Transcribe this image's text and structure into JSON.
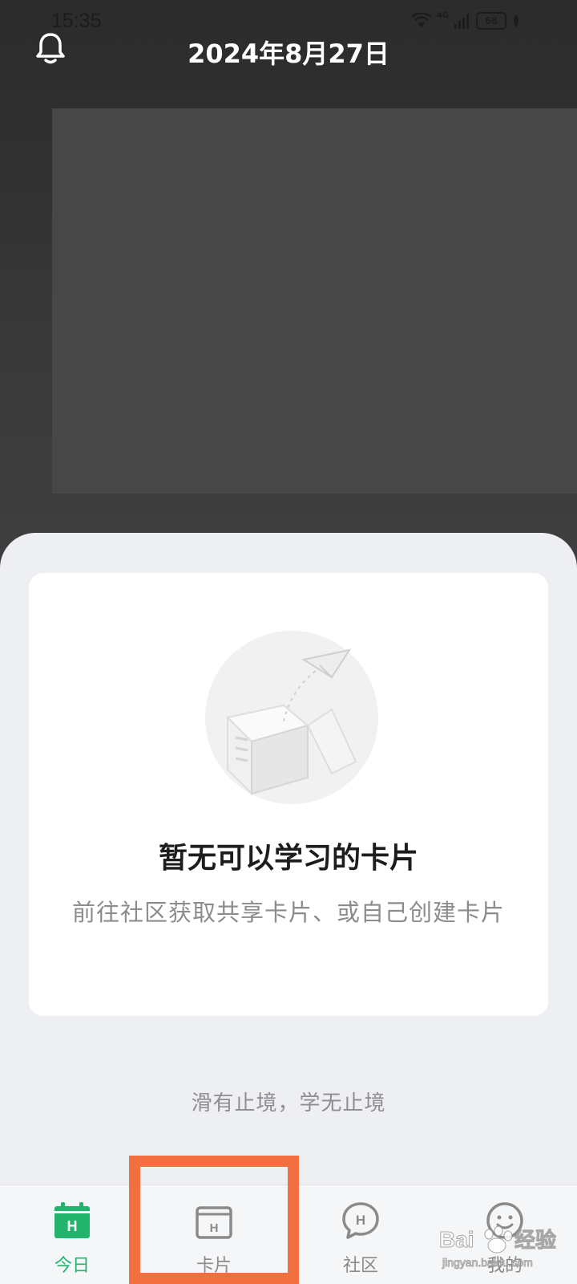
{
  "status_bar": {
    "time": "15:35",
    "network": "4G",
    "battery": "68"
  },
  "header": {
    "date": "2024年8月27日",
    "bell_icon": "bell-icon"
  },
  "empty_state": {
    "illustration": "empty-box-paper-plane",
    "title": "暂无可以学习的卡片",
    "description": "前往社区获取共享卡片、或自己创建卡片"
  },
  "slogan": "滑有止境，学无止境",
  "tabs": [
    {
      "label": "今日",
      "icon": "calendar-icon",
      "active": true
    },
    {
      "label": "卡片",
      "icon": "card-box-icon",
      "active": false
    },
    {
      "label": "社区",
      "icon": "chat-bubble-icon",
      "active": false
    },
    {
      "label": "我的",
      "icon": "smiley-icon",
      "active": false
    }
  ],
  "colors": {
    "accent_green": "#22b36c",
    "highlight_orange": "#f2703f",
    "sheet_bg": "#eeeff3",
    "header_bg": "#333333"
  },
  "watermark": {
    "text": "Bai 经验",
    "subtext": "jingyan.baidu.com"
  }
}
